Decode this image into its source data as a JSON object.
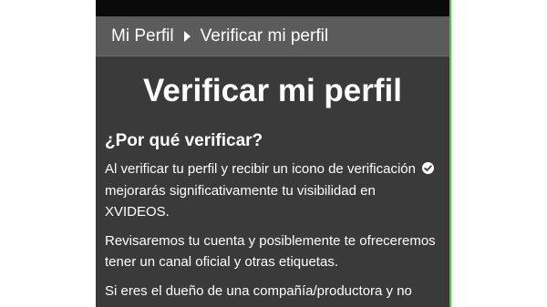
{
  "breadcrumb": {
    "parent": "Mi Perfil",
    "current": "Verificar mi perfil"
  },
  "page": {
    "title": "Verificar mi perfil",
    "section_heading": "¿Por qué verificar?",
    "paragraphs": [
      "Al verificar tu perfil y recibir un icono de verificación",
      "mejorarás significativamente tu visibilidad en XVIDEOS.",
      "Revisaremos tu cuenta y posiblemente te ofreceremos tener un canal oficial y otras etiquetas.",
      "Si eres el dueño de una compañía/productora y no"
    ]
  },
  "icons": {
    "breadcrumb_separator": "caret-right-icon",
    "verified": "check-circle-icon"
  },
  "colors": {
    "background": "#3a3a3a",
    "breadcrumb_bar": "#5b5b5b",
    "status_bar": "#0a0a0a",
    "text": "#ffffff",
    "edge_accent": "#3fd13f"
  }
}
